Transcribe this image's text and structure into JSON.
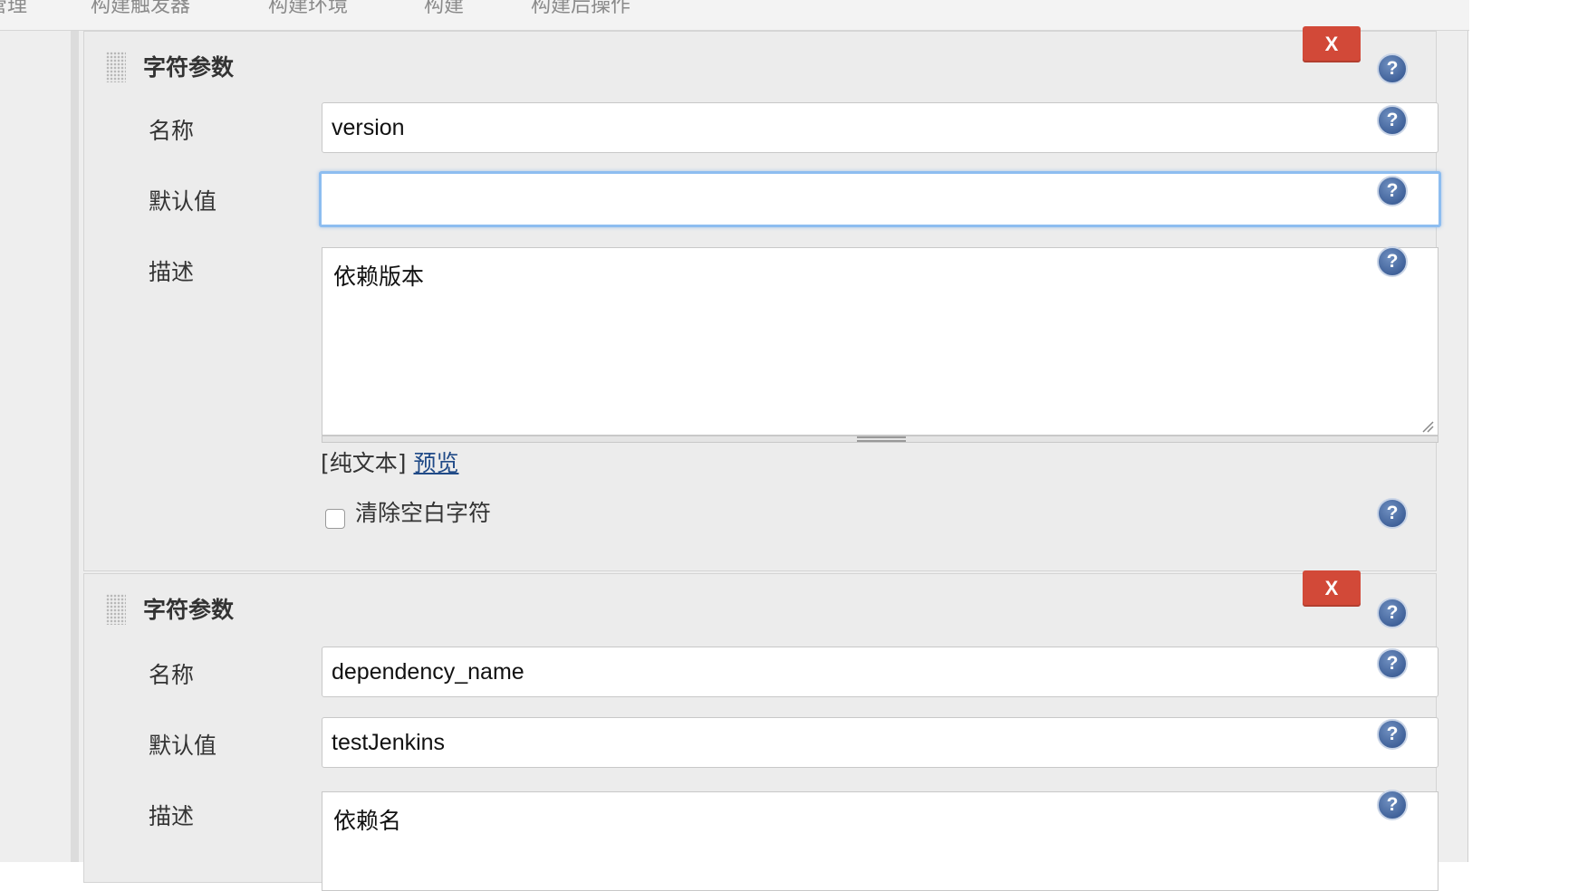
{
  "tabs": [
    "管理",
    "构建触发器",
    "构建环境",
    "构建",
    "构建后操作"
  ],
  "parameters": [
    {
      "title": "字符参数",
      "delete_label": "X",
      "name_label": "名称",
      "name_value": "version",
      "default_label": "默认值",
      "default_value": "",
      "desc_label": "描述",
      "desc_value": "依赖版本",
      "format_prefix": "[纯文本]",
      "preview_label": "预览",
      "trim_label": "清除空白字符",
      "trim_checked": false
    },
    {
      "title": "字符参数",
      "delete_label": "X",
      "name_label": "名称",
      "name_value": "dependency_name",
      "default_label": "默认值",
      "default_value": "testJenkins",
      "desc_label": "描述",
      "desc_value": "依赖名"
    }
  ],
  "help_icon_glyph": "?",
  "colors": {
    "delete_button": "#d24938",
    "help_icon": "#2d4f8a",
    "focus_ring": "#8dbdf0",
    "link": "#204a87"
  }
}
